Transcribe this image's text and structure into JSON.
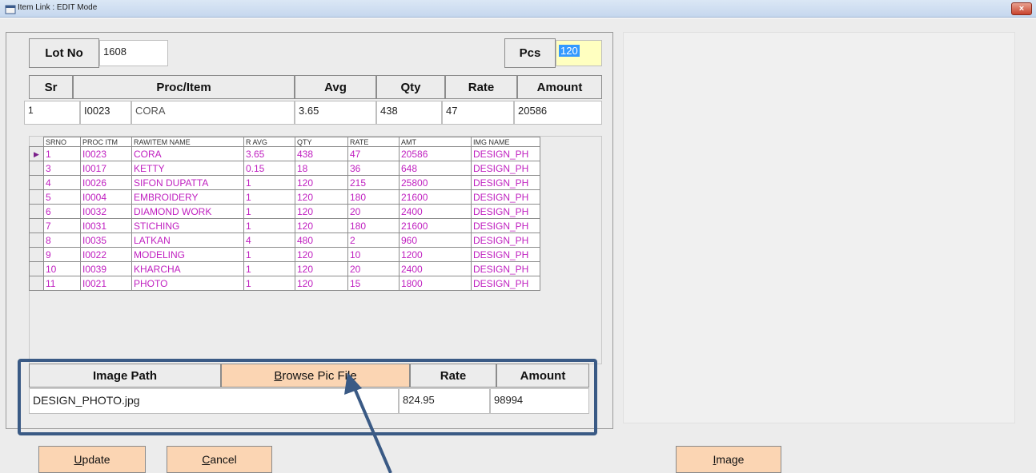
{
  "window": {
    "title": "Item Link : EDIT Mode",
    "close_glyph": "×"
  },
  "lot": {
    "label": "Lot No",
    "value": "1608"
  },
  "pcs": {
    "label": "Pcs",
    "value": "120"
  },
  "summary": {
    "headers": [
      "Sr",
      "Proc/Item",
      "Avg",
      "Qty",
      "Rate",
      "Amount"
    ],
    "row": {
      "sr": "1",
      "code": "I0023",
      "name": "CORA",
      "avg": "3.65",
      "qty": "438",
      "rate": "47",
      "amount": "20586"
    }
  },
  "grid": {
    "columns": [
      "SRNO",
      "PROC ITM",
      "RAWITEM NAME",
      "R AVG",
      "QTY",
      "RATE",
      "AMT",
      "IMG NAME"
    ],
    "rows": [
      [
        "1",
        "I0023",
        "CORA",
        "3.65",
        "438",
        "47",
        "20586",
        "DESIGN_PH"
      ],
      [
        "3",
        "I0017",
        "KETTY",
        "0.15",
        "18",
        "36",
        "648",
        "DESIGN_PH"
      ],
      [
        "4",
        "I0026",
        "SIFON DUPATTA",
        "1",
        "120",
        "215",
        "25800",
        "DESIGN_PH"
      ],
      [
        "5",
        "I0004",
        "EMBROIDERY",
        "1",
        "120",
        "180",
        "21600",
        "DESIGN_PH"
      ],
      [
        "6",
        "I0032",
        "DIAMOND WORK",
        "1",
        "120",
        "20",
        "2400",
        "DESIGN_PH"
      ],
      [
        "7",
        "I0031",
        "STICHING",
        "1",
        "120",
        "180",
        "21600",
        "DESIGN_PH"
      ],
      [
        "8",
        "I0035",
        "LATKAN",
        "4",
        "480",
        "2",
        "960",
        "DESIGN_PH"
      ],
      [
        "9",
        "I0022",
        "MODELING",
        "1",
        "120",
        "10",
        "1200",
        "DESIGN_PH"
      ],
      [
        "10",
        "I0039",
        "KHARCHA",
        "1",
        "120",
        "20",
        "2400",
        "DESIGN_PH"
      ],
      [
        "11",
        "I0021",
        "PHOTO",
        "1",
        "120",
        "15",
        "1800",
        "DESIGN_PH"
      ]
    ],
    "selected_indicator": "▶",
    "text_color": "#c020c0"
  },
  "image_section": {
    "path_label": "Image Path",
    "browse_label_first": "B",
    "browse_label_rest": "rowse Pic File",
    "rate_label": "Rate",
    "amount_label": "Amount",
    "path_value": "DESIGN_PHOTO.jpg",
    "rate_value": "824.95",
    "amount_value": "98994"
  },
  "buttons": {
    "update_first": "U",
    "update_rest": "pdate",
    "cancel_first": "C",
    "cancel_rest": "ancel",
    "image_first": "I",
    "image_rest": "mage"
  },
  "colors": {
    "button_bg": "#fbd5b3",
    "highlight_border": "#3a5a85",
    "pcs_bg": "#ffffc0",
    "selection_blue": "#3399ff"
  }
}
